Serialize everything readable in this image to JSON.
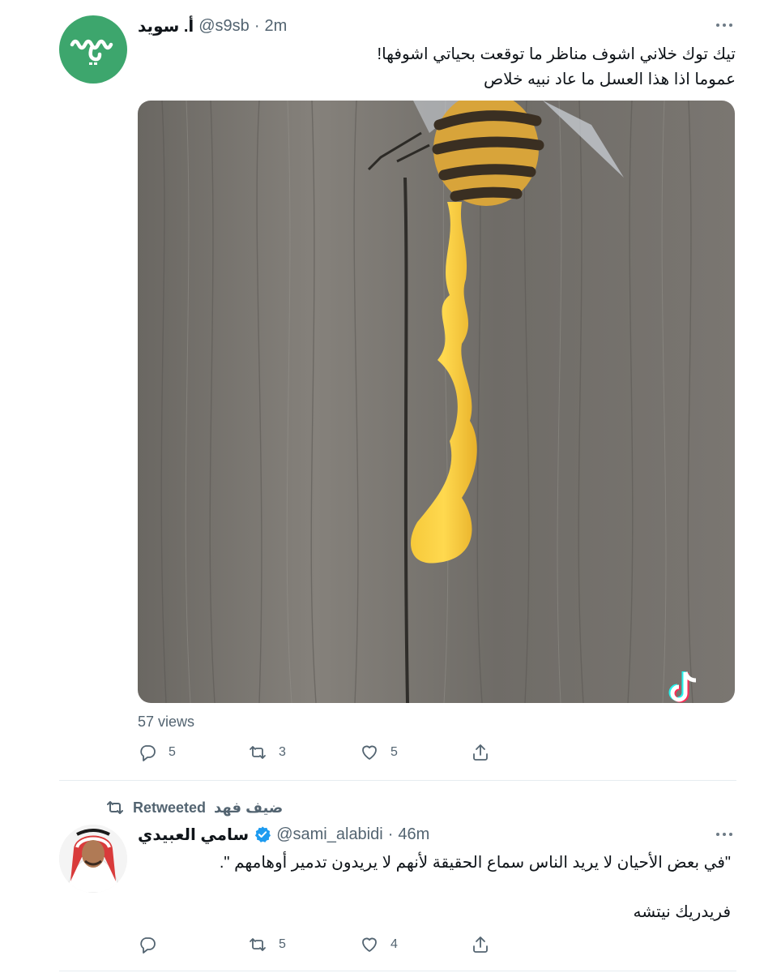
{
  "tweet1": {
    "name": "أ. سويد",
    "handle": "@s9sb",
    "sep": "·",
    "time": "2m",
    "line1": "تيك توك خلاني اشوف مناظر ما توقعت بحياتي اشوفها!",
    "line2": "عموما اذا هذا العسل ما عاد نبيه خلاص",
    "views": "57 views",
    "actions": {
      "replies": "5",
      "retweets": "3",
      "likes": "5"
    }
  },
  "tweet2": {
    "retweeted_by": "ضيف فهد",
    "retweeted_label": "Retweeted",
    "name": "سامي العبيدي",
    "handle": "@sami_alabidi",
    "sep": "·",
    "time": "46m",
    "line1": "\"في بعض الأحيان لا يريد الناس سماع الحقيقة لأنهم لا يريدون تدمير أوهامهم \".",
    "line2": "فريدريك نيتشه",
    "actions": {
      "replies": "",
      "retweets": "5",
      "likes": "4"
    }
  },
  "colors": {
    "avatar_green": "#3da66d",
    "honey": "#f1c232",
    "wood": "#77736d",
    "text_secondary": "#536471"
  },
  "icons": [
    "more-icon",
    "reply-icon",
    "retweet-icon",
    "like-icon",
    "share-icon",
    "verified-badge-icon",
    "tiktok-logo-icon"
  ]
}
